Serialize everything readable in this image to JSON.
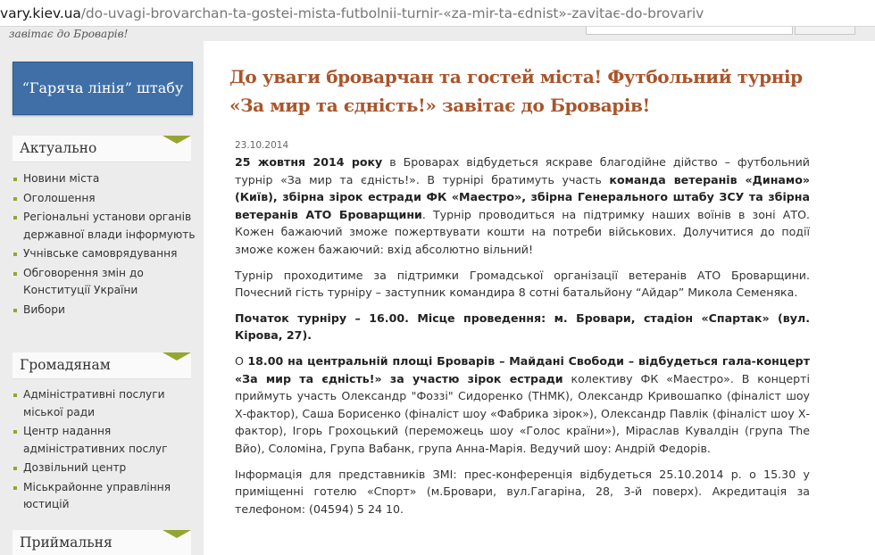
{
  "browser": {
    "url_host": "vary.kiev.ua",
    "url_path": "/do-uvagi-brovarchan-ta-gostei-mista-futbolnii-turnir-«za-mir-ta-єdnist»-zavitaє-do-brovariv"
  },
  "header": {
    "slogan": "завітає до Броварів!"
  },
  "sidebar": {
    "hotline_label": "“Гаряча лінія” штабу",
    "blocks": [
      {
        "title": "Актуально",
        "items": [
          "Новини міста",
          "Оголошення",
          "Регіональні установи органів державної влади інформують",
          "Учнівське самоврядування",
          "Обговорення змін до Конституції України",
          "Вибори"
        ]
      },
      {
        "title": "Громадянам",
        "items": [
          "Адміністративні послуги міської ради",
          "Центр надання адміністративних послуг",
          "Дозвільний центр",
          "Міськрайонне управління юстицій"
        ]
      },
      {
        "title": "Приймальня",
        "items": []
      }
    ],
    "accent_color": "#95a531"
  },
  "article": {
    "title": "До уваги броварчан та гостей міста! Футбольний турнір «За мир та єдність!» завітає до Броварів!",
    "date": "23.10.2014",
    "p1": {
      "b1": "25 жовтня 2014 року",
      "t1": " в Броварах відбудеться яскраве благодійне дійство – футбольний турнір «За мир та єдність!». В турнірі братимуть участь ",
      "b2": "команда ветеранів «Динамо» (Київ), збірна зірок естради ФК «Маестро», збірна Генерального штабу ЗСУ та збірна ветеранів АТО Броварщини",
      "t2": ". Турнір проводиться на підтримку наших воїнів в зоні АТО. Кожен бажаючий зможе пожертвувати кошти на потреби військових. Долучитися до події зможе кожен бажаючий: вхід абсолютно вільний!"
    },
    "p2": "Турнір проходитиме за підтримки Громадської організації ветеранів АТО Броварщини. Почесний гість турніру – заступник командира 8 сотні батальйону “Айдар” Микола Семеняка.",
    "p3": "Початок турніру – 16.00. Місце проведення: м. Бровари, стадіон «Спартак» (вул. Кірова, 27).",
    "p4": {
      "t1": "О ",
      "b1": "18.00 на центральній площі Броварів – Майдані Свободи – відбудеться гала-концерт «За мир та єдність!» за участю зірок естради",
      "t2": " колективу ФК «Маестро». В концерті приймуть участь  Олександр \"Фоззі\" Сидоренко (ТНМК), Олександр Кривошапко (фіналіст шоу Х-фактор), Саша Борисенко (фіналіст шоу «Фабрика зірок»), Олександр Павлік (фіналіст шоу Х-фактор), Ігорь Грохоцький (переможець шоу «Голос країни»), Міраслав Кувалдін (група The Вйо), Соломіна, Група Вабанк, група Анна-Марія. Ведучий шоу: Андрій Федорів."
    },
    "p5": "Інформація для представників ЗМІ: прес-конференція відбудеться 25.10.2014 р. о 15.30 у приміщенні готелю «Спорт» (м.Бровари, вул.Гагаріна, 28, 3-й поверх). Акредитація за телефоном: (04594) 5 24 10.",
    "title_color": "#a8552c"
  }
}
